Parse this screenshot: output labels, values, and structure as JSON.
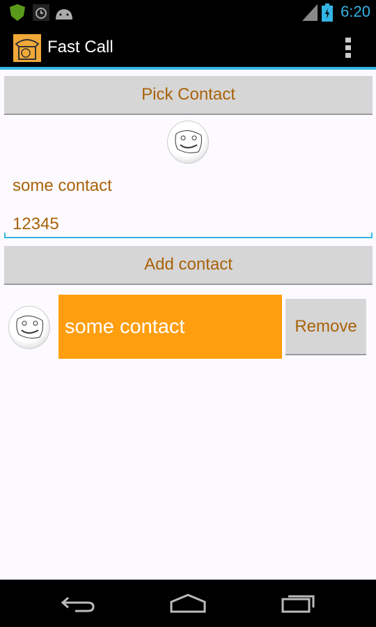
{
  "status_bar": {
    "time": "6:20",
    "icons": [
      "shield-app-icon",
      "alarm-icon",
      "android-icon",
      "signal-icon",
      "battery-charging-icon"
    ]
  },
  "action_bar": {
    "title": "Fast Call",
    "app_icon": "rotary-phone-icon",
    "menu_icon": "overflow-menu-icon"
  },
  "main": {
    "pick_contact_label": "Pick Contact",
    "name_field_value": "some contact",
    "number_field_value": "12345",
    "add_contact_label": "Add contact",
    "contacts": [
      {
        "name": "some contact",
        "remove_label": "Remove"
      }
    ]
  },
  "colors": {
    "accent": "#33b5e5",
    "text": "#a8620a",
    "contact_bg": "#ff9e0f"
  },
  "nav_bar": {
    "icons": [
      "back-icon",
      "home-icon",
      "recents-icon"
    ]
  }
}
